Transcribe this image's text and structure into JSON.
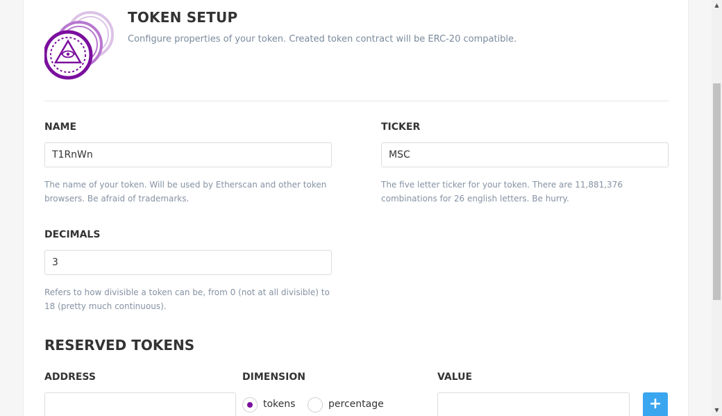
{
  "header": {
    "title": "TOKEN SETUP",
    "description": "Configure properties of your token. Created token contract will be ERC-20 compatible."
  },
  "name_field": {
    "label": "NAME",
    "value": "T1RnWn",
    "hint": "The name of your token. Will be used by Etherscan and other token browsers. Be afraid of trademarks."
  },
  "ticker_field": {
    "label": "TICKER",
    "value": "MSC",
    "hint": "The five letter ticker for your token. There are 11,881,376 combinations for 26 english letters. Be hurry."
  },
  "decimals_field": {
    "label": "DECIMALS",
    "value": "3",
    "hint": "Refers to how divisible a token can be, from 0 (not at all divisible) to 18 (pretty much continuous)."
  },
  "reserved": {
    "title": "RESERVED TOKENS",
    "address_label": "ADDRESS",
    "address_value": "",
    "dimension_label": "DIMENSION",
    "dimension_options": [
      "tokens",
      "percentage"
    ],
    "dimension_selected": "tokens",
    "value_label": "VALUE",
    "value_value": "",
    "add_button_label": "+"
  },
  "colors": {
    "accent": "#7a0f9e",
    "button": "#3aa6f0",
    "hint_text": "#8592a3"
  },
  "icons": {
    "logo": "coin-stack-eye-icon",
    "add": "plus-icon",
    "scroll_up": "scroll-up-arrow",
    "scroll_down": "scroll-down-arrow"
  }
}
